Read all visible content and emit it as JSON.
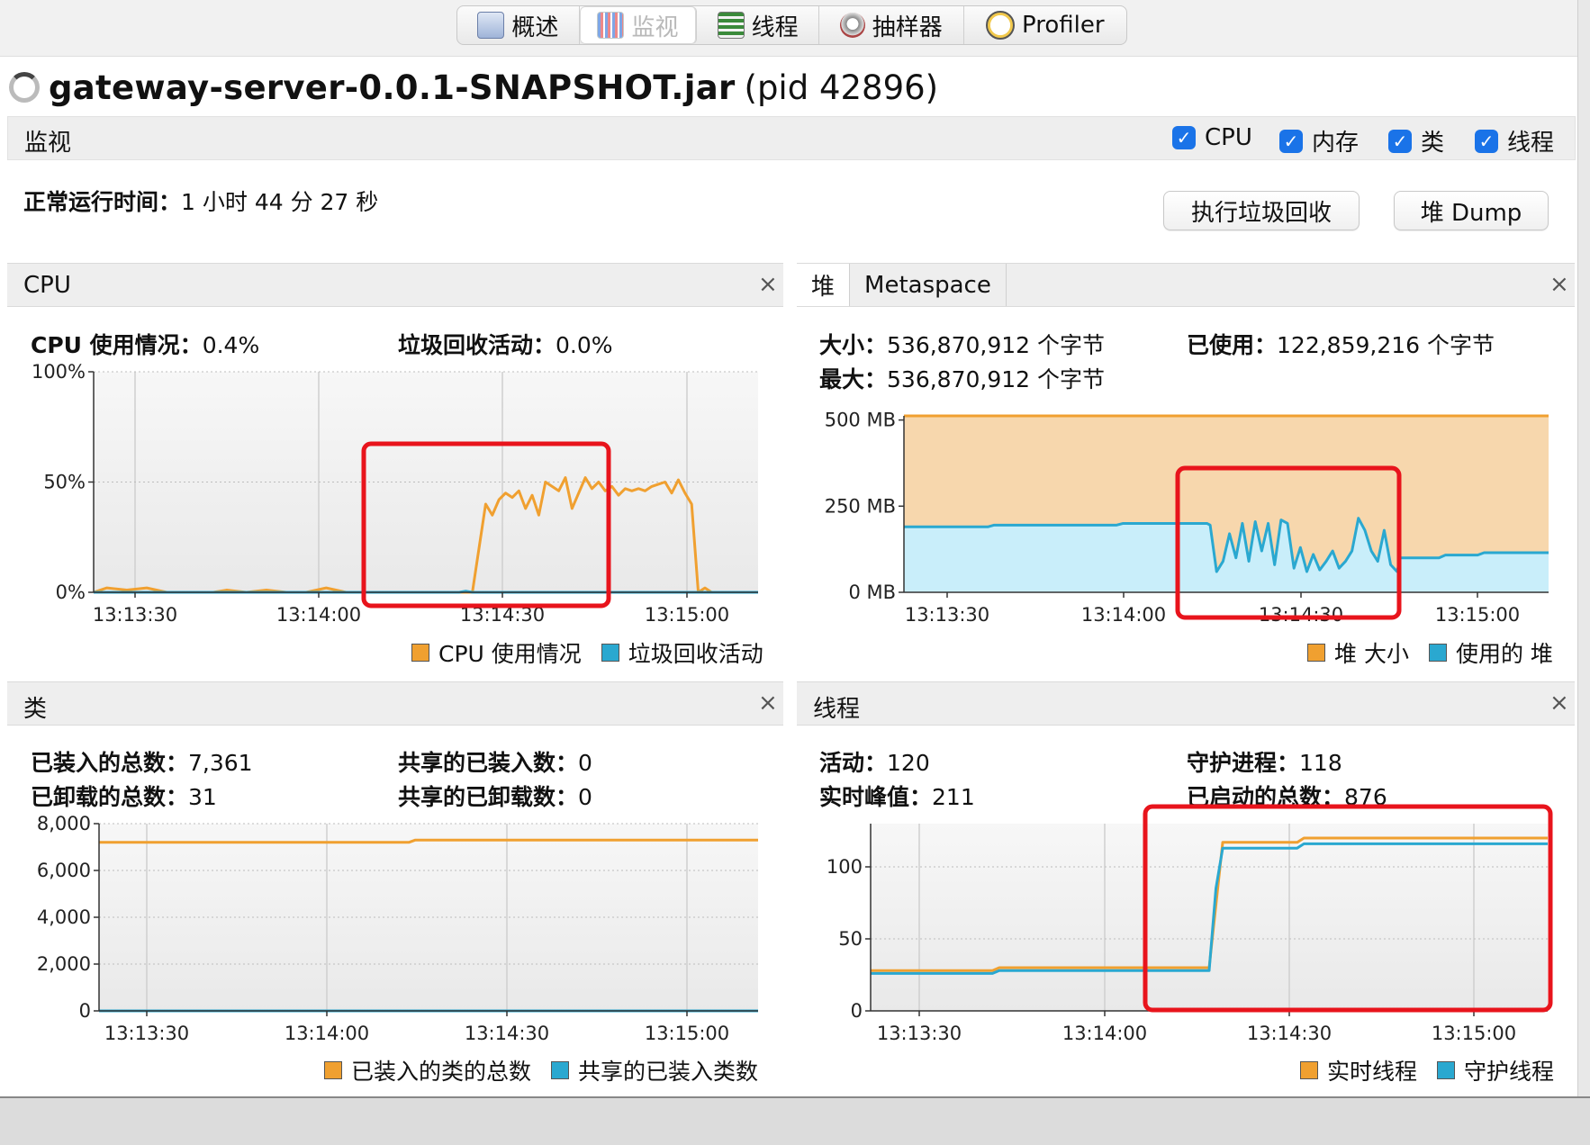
{
  "toolbar": {
    "tabs": [
      {
        "label": "概述",
        "icon": "overview-icon"
      },
      {
        "label": "监视",
        "icon": "monitor-icon"
      },
      {
        "label": "线程",
        "icon": "threads-icon"
      },
      {
        "label": "抽样器",
        "icon": "sampler-icon"
      },
      {
        "label": "Profiler",
        "icon": "profiler-icon"
      }
    ],
    "active_tab": "监视"
  },
  "app": {
    "name": "gateway-server-0.0.1-SNAPSHOT.jar",
    "pid": "(pid 42896)"
  },
  "monitor": {
    "label": "监视",
    "checkboxes": [
      {
        "label": "CPU",
        "checked": true
      },
      {
        "label": "内存",
        "checked": true
      },
      {
        "label": "类",
        "checked": true
      },
      {
        "label": "线程",
        "checked": true
      }
    ]
  },
  "uptime": {
    "label": "正常运行时间：",
    "value": "1 小时 44 分 27 秒"
  },
  "buttons": {
    "gc": "执行垃圾回收",
    "heap_dump": "堆 Dump"
  },
  "colors": {
    "orange": "#f0a030",
    "blue": "#2aa8d0",
    "highlight": "#e8141c",
    "heap_fill": "#f7d7ad",
    "used_fill": "#c9eefa"
  },
  "cpu_panel": {
    "title": "CPU",
    "close": "×",
    "usage_label": "CPU 使用情况：",
    "usage_value": "0.4%",
    "gc_label": "垃圾回收活动：",
    "gc_value": "0.0%",
    "legend": [
      "CPU 使用情况",
      "垃圾回收活动"
    ]
  },
  "heap_panel": {
    "tabs": [
      "堆",
      "Metaspace"
    ],
    "close": "×",
    "size_label": "大小：",
    "size_value": "536,870,912 个字节",
    "used_label": "已使用：",
    "used_value": "122,859,216 个字节",
    "max_label": "最大：",
    "max_value": "536,870,912 个字节",
    "legend": [
      "堆 大小",
      "使用的 堆"
    ]
  },
  "classes_panel": {
    "title": "类",
    "close": "×",
    "loaded_label": "已装入的总数：",
    "loaded_value": "7,361",
    "shared_loaded_label": "共享的已装入数：",
    "shared_loaded_value": "0",
    "unloaded_label": "已卸载的总数：",
    "unloaded_value": "31",
    "shared_unloaded_label": "共享的已卸载数：",
    "shared_unloaded_value": "0",
    "legend": [
      "已装入的类的总数",
      "共享的已装入类数"
    ]
  },
  "threads_panel": {
    "title": "线程",
    "close": "×",
    "live_label": "活动：",
    "live_value": "120",
    "daemon_label": "守护进程：",
    "daemon_value": "118",
    "peak_label": "实时峰值：",
    "peak_value": "211",
    "started_label": "已启动的总数：",
    "started_value": "876",
    "legend": [
      "实时线程",
      "守护线程"
    ]
  },
  "chart_data": [
    {
      "id": "cpu",
      "type": "line",
      "x_ticks": [
        "13:13:30",
        "13:14:00",
        "13:14:30",
        "13:15:00"
      ],
      "y_ticks": [
        "100%",
        "50%",
        "0%"
      ],
      "ylim": [
        0,
        100
      ],
      "series": [
        {
          "name": "CPU 使用情况",
          "color": "#f0a030",
          "x": [
            0,
            2,
            5,
            8,
            11,
            14,
            16,
            18,
            20,
            23,
            26,
            29,
            32,
            35,
            38,
            41,
            44,
            47,
            50,
            53,
            55,
            57,
            58,
            59,
            60,
            61,
            62,
            63,
            64,
            65,
            66,
            67,
            68,
            69,
            70,
            71,
            72,
            73,
            74,
            75,
            76,
            77,
            78,
            79,
            80,
            81,
            82,
            83,
            84,
            85,
            86,
            87,
            88,
            89,
            90,
            91,
            92,
            93,
            95,
            100
          ],
          "y": [
            0,
            2,
            1,
            2,
            0,
            0,
            0,
            0,
            1,
            0,
            1,
            0,
            0,
            2,
            0,
            0,
            0,
            0,
            0,
            0,
            0,
            0,
            20,
            40,
            35,
            42,
            45,
            43,
            46,
            38,
            44,
            35,
            50,
            48,
            46,
            52,
            38,
            45,
            52,
            47,
            50,
            46,
            48,
            44,
            47,
            46,
            47,
            46,
            48,
            49,
            50,
            45,
            51,
            45,
            40,
            0,
            2,
            0,
            0,
            0
          ]
        },
        {
          "name": "垃圾回收活动",
          "color": "#2aa8d0",
          "x": [
            0,
            55,
            56,
            57,
            58,
            100
          ],
          "y": [
            0,
            0,
            0.5,
            0,
            0,
            0
          ]
        }
      ]
    },
    {
      "id": "heap",
      "type": "area",
      "x_ticks": [
        "13:13:30",
        "13:14:00",
        "13:14:30",
        "13:15:00"
      ],
      "y_ticks": [
        "500 MB",
        "250 MB",
        "0 MB"
      ],
      "ylim": [
        0,
        512
      ],
      "series": [
        {
          "name": "堆 大小",
          "color": "#f0a030",
          "x": [
            0,
            100
          ],
          "y": [
            512,
            512
          ]
        },
        {
          "name": "使用的 堆",
          "color": "#2aa8d0",
          "x": [
            0,
            13,
            14,
            33,
            34,
            47,
            47.5,
            48.5,
            49.5,
            50.5,
            51.5,
            52.5,
            53.5,
            54.5,
            55.5,
            56.5,
            57.5,
            58.5,
            59.5,
            60.5,
            61.5,
            62.5,
            63.5,
            64.5,
            65.5,
            66.5,
            67.5,
            68.5,
            69.5,
            70.5,
            71.5,
            72.5,
            73.5,
            74.5,
            75.5,
            76.5,
            77,
            78,
            83,
            84,
            89,
            90,
            100
          ],
          "y": [
            190,
            190,
            195,
            195,
            200,
            200,
            195,
            60,
            90,
            170,
            100,
            200,
            90,
            205,
            120,
            200,
            80,
            210,
            200,
            70,
            130,
            60,
            110,
            65,
            90,
            120,
            70,
            90,
            120,
            215,
            180,
            120,
            90,
            180,
            80,
            60,
            100,
            100,
            100,
            108,
            108,
            115,
            115
          ]
        }
      ]
    },
    {
      "id": "classes",
      "type": "line",
      "x_ticks": [
        "13:13:30",
        "13:14:00",
        "13:14:30",
        "13:15:00"
      ],
      "y_ticks": [
        "8,000",
        "6,000",
        "4,000",
        "2,000",
        "0"
      ],
      "ylim": [
        0,
        8000
      ],
      "series": [
        {
          "name": "已装入的类的总数",
          "color": "#f0a030",
          "x": [
            0,
            47,
            48,
            100
          ],
          "y": [
            7200,
            7200,
            7300,
            7300
          ]
        },
        {
          "name": "共享的已装入类数",
          "color": "#2aa8d0",
          "x": [
            0,
            100
          ],
          "y": [
            0,
            0
          ]
        }
      ]
    },
    {
      "id": "threads",
      "type": "line",
      "x_ticks": [
        "13:13:30",
        "13:14:00",
        "13:14:30",
        "13:15:00"
      ],
      "y_ticks": [
        "100",
        "50",
        "0"
      ],
      "ylim": [
        0,
        130
      ],
      "series": [
        {
          "name": "实时线程",
          "color": "#f0a030",
          "x": [
            0,
            18,
            19,
            49,
            50,
            52,
            53,
            63,
            64,
            100
          ],
          "y": [
            28,
            28,
            30,
            30,
            30,
            117,
            117,
            117,
            120,
            120
          ]
        },
        {
          "name": "守护线程",
          "color": "#2aa8d0",
          "x": [
            0,
            18,
            19,
            49,
            50,
            51,
            52,
            53,
            63,
            64,
            100
          ],
          "y": [
            26,
            26,
            28,
            28,
            28,
            85,
            113,
            113,
            113,
            116,
            116
          ]
        }
      ]
    }
  ]
}
